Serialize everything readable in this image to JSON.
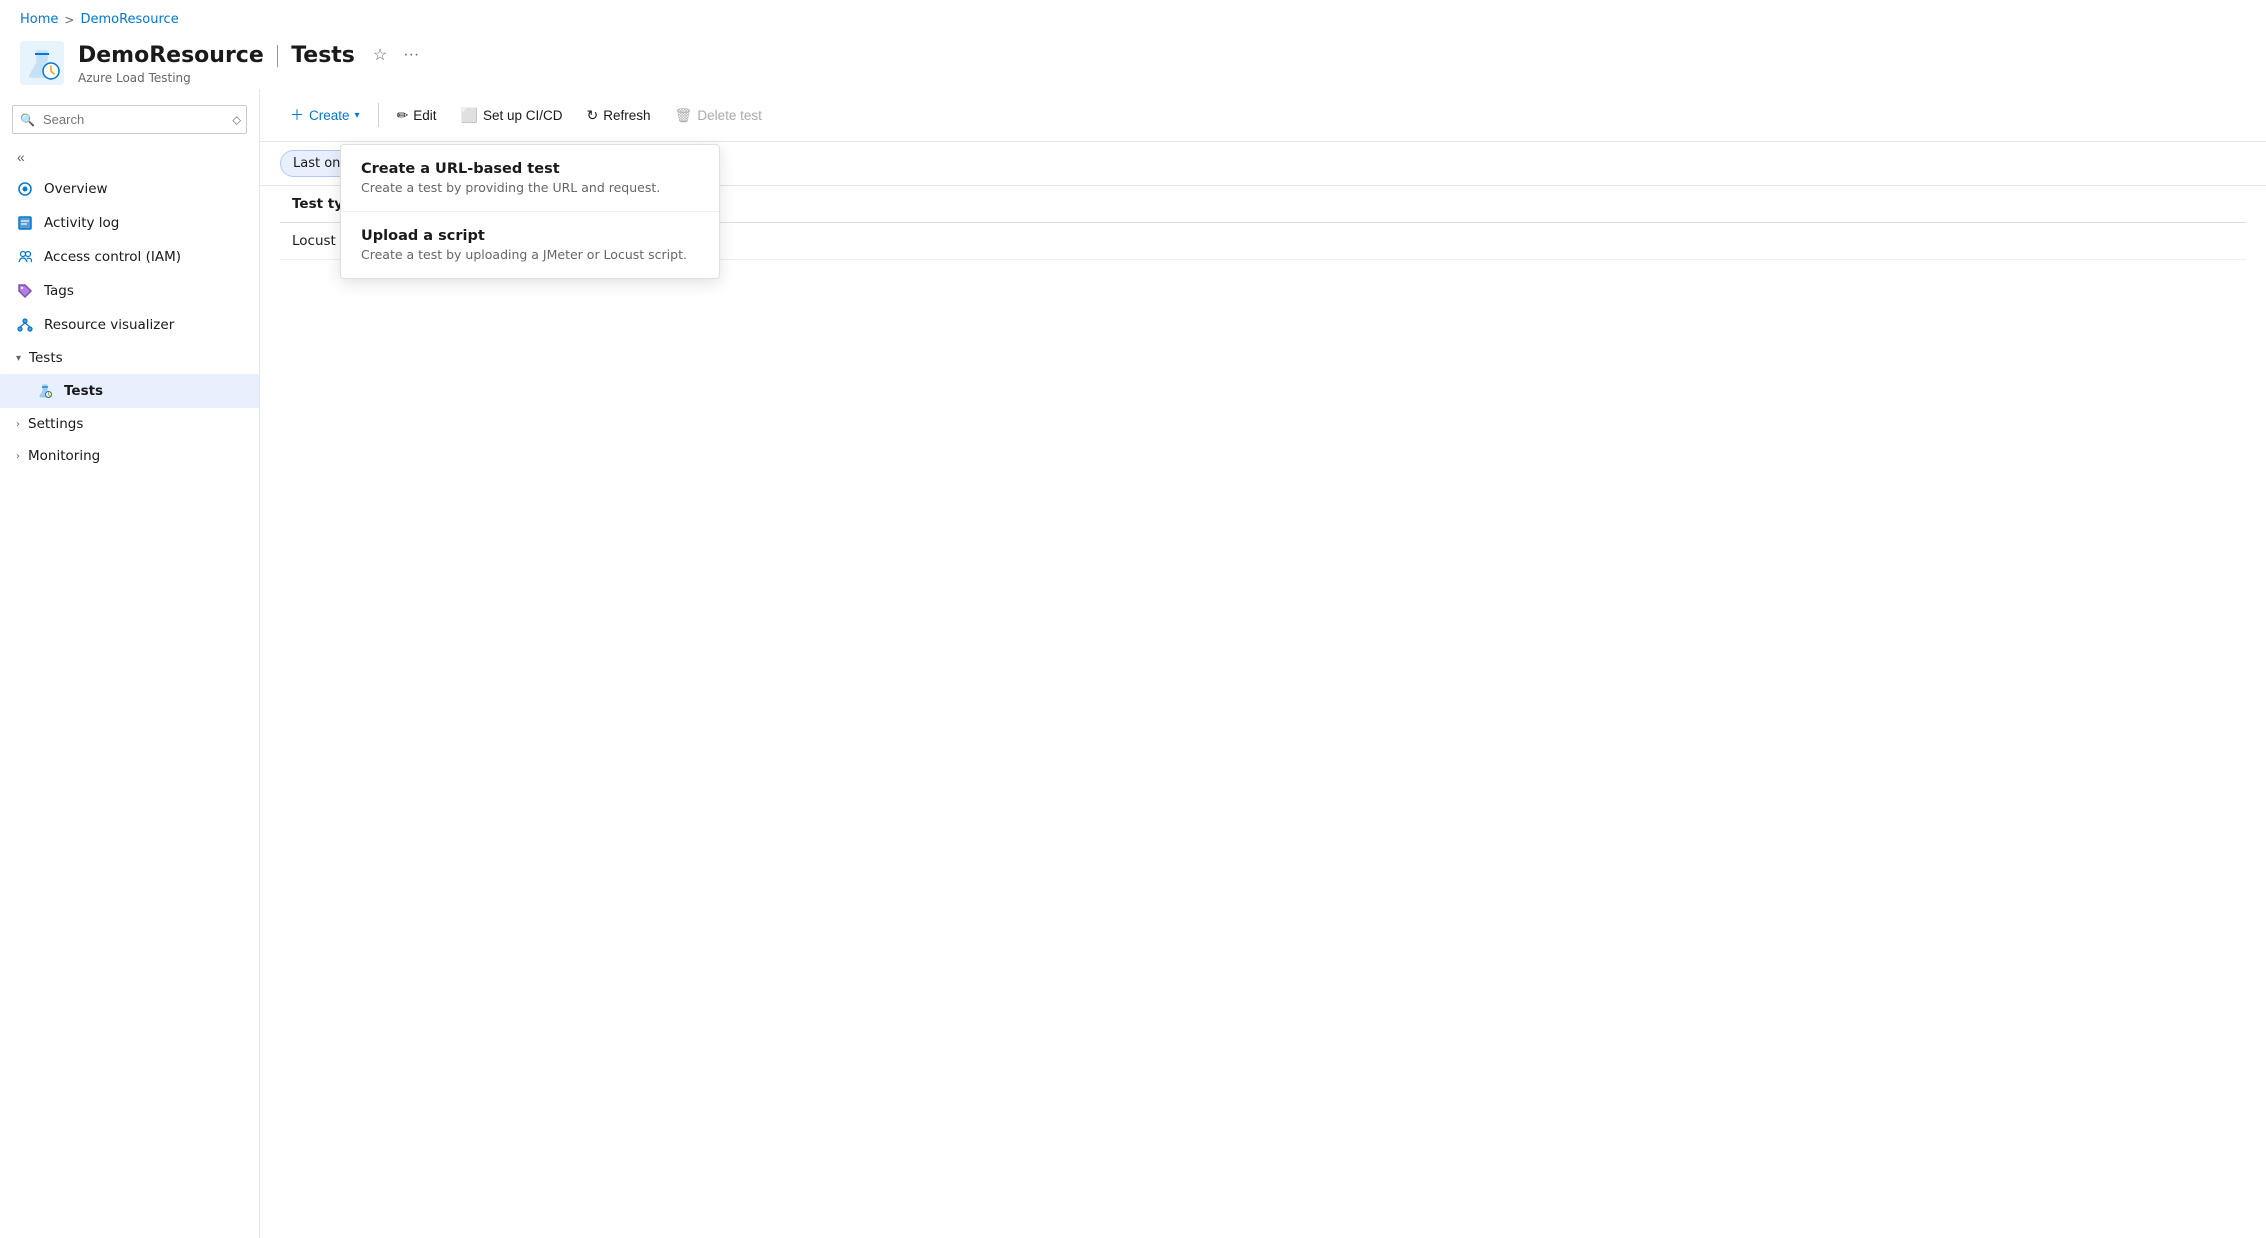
{
  "breadcrumb": {
    "home": "Home",
    "separator": ">",
    "resource": "DemoResource"
  },
  "header": {
    "title": "DemoResource",
    "pipe": "|",
    "section": "Tests",
    "subtitle": "Azure Load Testing"
  },
  "search": {
    "placeholder": "Search"
  },
  "sidebar": {
    "items": [
      {
        "id": "overview",
        "label": "Overview",
        "icon": "overview"
      },
      {
        "id": "activity-log",
        "label": "Activity log",
        "icon": "activity"
      },
      {
        "id": "access-control",
        "label": "Access control (IAM)",
        "icon": "iam"
      },
      {
        "id": "tags",
        "label": "Tags",
        "icon": "tags"
      },
      {
        "id": "resource-visualizer",
        "label": "Resource visualizer",
        "icon": "visualizer"
      }
    ],
    "sections": [
      {
        "id": "tests",
        "label": "Tests",
        "expanded": true,
        "children": [
          {
            "id": "tests-sub",
            "label": "Tests",
            "icon": "flask",
            "active": true
          }
        ]
      },
      {
        "id": "settings",
        "label": "Settings",
        "expanded": false,
        "children": []
      },
      {
        "id": "monitoring",
        "label": "Monitoring",
        "expanded": false,
        "children": []
      }
    ]
  },
  "toolbar": {
    "create_label": "Create",
    "edit_label": "Edit",
    "cicd_label": "Set up CI/CD",
    "refresh_label": "Refresh",
    "delete_label": "Delete test"
  },
  "filter": {
    "label": "Last one month"
  },
  "dropdown": {
    "items": [
      {
        "title": "Create a URL-based test",
        "description": "Create a test by providing the URL and request."
      },
      {
        "title": "Upload a script",
        "description": "Create a test by uploading a JMeter or Locust script."
      }
    ]
  },
  "table": {
    "headers": [
      "Test type"
    ],
    "rows": [
      {
        "test_type": "Locust"
      }
    ]
  }
}
